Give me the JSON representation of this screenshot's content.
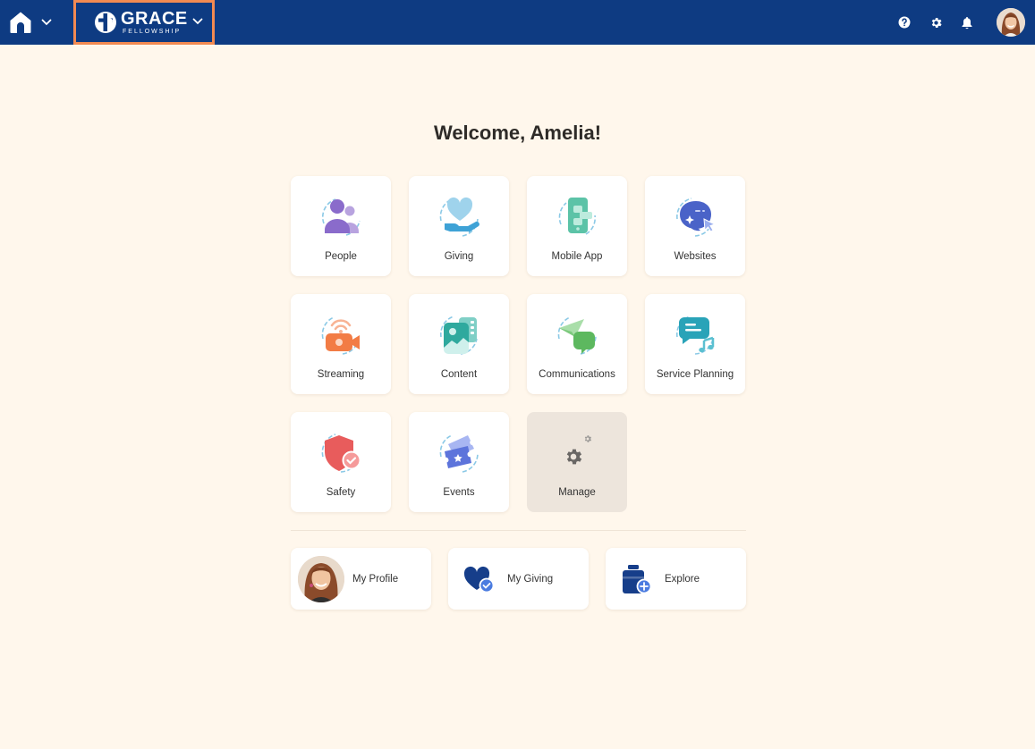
{
  "header": {
    "org_name": "GRACE",
    "org_subtitle": "FELLOWSHIP",
    "icons": [
      "home-icon",
      "chevron-down-icon",
      "help-icon",
      "gear-icon",
      "bell-icon",
      "avatar"
    ],
    "brand_color": "#0E3B82",
    "highlight_color": "#F28A52"
  },
  "welcome": "Welcome, Amelia!",
  "apps": [
    {
      "label": "People",
      "icon": "people-icon"
    },
    {
      "label": "Giving",
      "icon": "giving-icon"
    },
    {
      "label": "Mobile App",
      "icon": "mobile-app-icon"
    },
    {
      "label": "Websites",
      "icon": "websites-icon"
    },
    {
      "label": "Streaming",
      "icon": "streaming-icon"
    },
    {
      "label": "Content",
      "icon": "content-icon"
    },
    {
      "label": "Communications",
      "icon": "communications-icon"
    },
    {
      "label": "Service Planning",
      "icon": "service-planning-icon"
    },
    {
      "label": "Safety",
      "icon": "safety-icon"
    },
    {
      "label": "Events",
      "icon": "events-icon"
    },
    {
      "label": "Manage",
      "icon": "manage-gear-icon"
    }
  ],
  "quick_links": [
    {
      "label": "My Profile",
      "icon": "profile-avatar"
    },
    {
      "label": "My Giving",
      "icon": "heart-check-icon"
    },
    {
      "label": "Explore",
      "icon": "explore-plus-icon"
    }
  ]
}
